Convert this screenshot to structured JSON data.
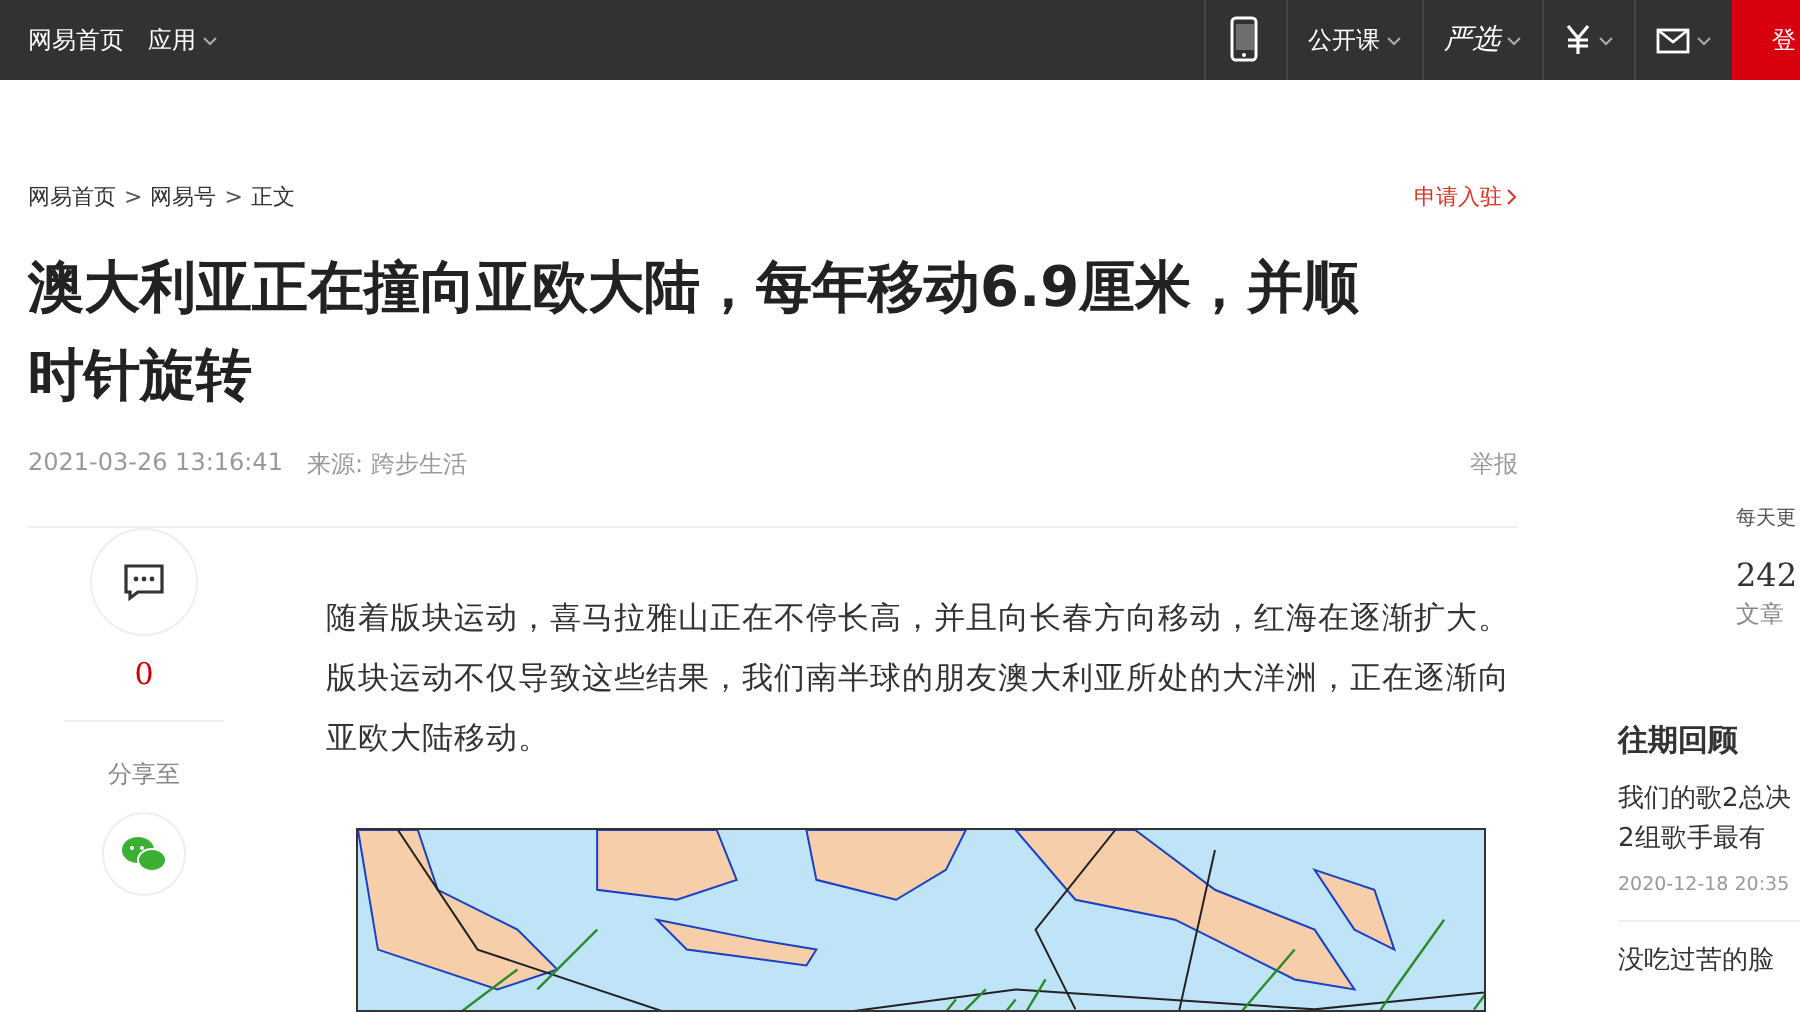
{
  "top_bar": {
    "home": "网易首页",
    "apps": "应用",
    "right_items": [
      {
        "kind": "phone"
      },
      {
        "kind": "text",
        "label": "公开课"
      },
      {
        "kind": "brand",
        "label": "严选"
      },
      {
        "kind": "yuan"
      },
      {
        "kind": "mail"
      }
    ],
    "login": "登"
  },
  "breadcrumb": [
    {
      "kind": "link",
      "label": "网易首页"
    },
    {
      "kind": "separator",
      "label": ">"
    },
    {
      "kind": "link",
      "label": "网易号"
    },
    {
      "kind": "separator",
      "label": ">"
    },
    {
      "kind": "link",
      "label": "正文"
    }
  ],
  "apply_link": "申请入驻",
  "article": {
    "title": "澳大利亚正在撞向亚欧大陆，每年移动6.9厘米，并顺时针旋转",
    "time": "2021-03-26 13:16:41",
    "source": "来源: 跨步生活",
    "report": "举报",
    "paragraph": "随着版块运动，喜马拉雅山正在不停长高，并且向长春方向移动，红海在逐渐扩大。版块运动不仅导致这些结果，我们南半球的朋友澳大利亚所处的大洋洲，正在逐渐向亚欧大陆移动。"
  },
  "side_rail": {
    "comment_count": "0",
    "share_label": "分享至"
  },
  "sidebar": {
    "tagline": "每天更",
    "count": "242",
    "count_label": "文章",
    "section_title": "往期回顾",
    "posts": [
      {
        "title_lines": [
          "我们的歌2总决",
          "2组歌手最有"
        ],
        "date": "2020-12-18 20:35"
      },
      {
        "title_lines": [
          "没吃过苦的脸"
        ]
      }
    ]
  }
}
